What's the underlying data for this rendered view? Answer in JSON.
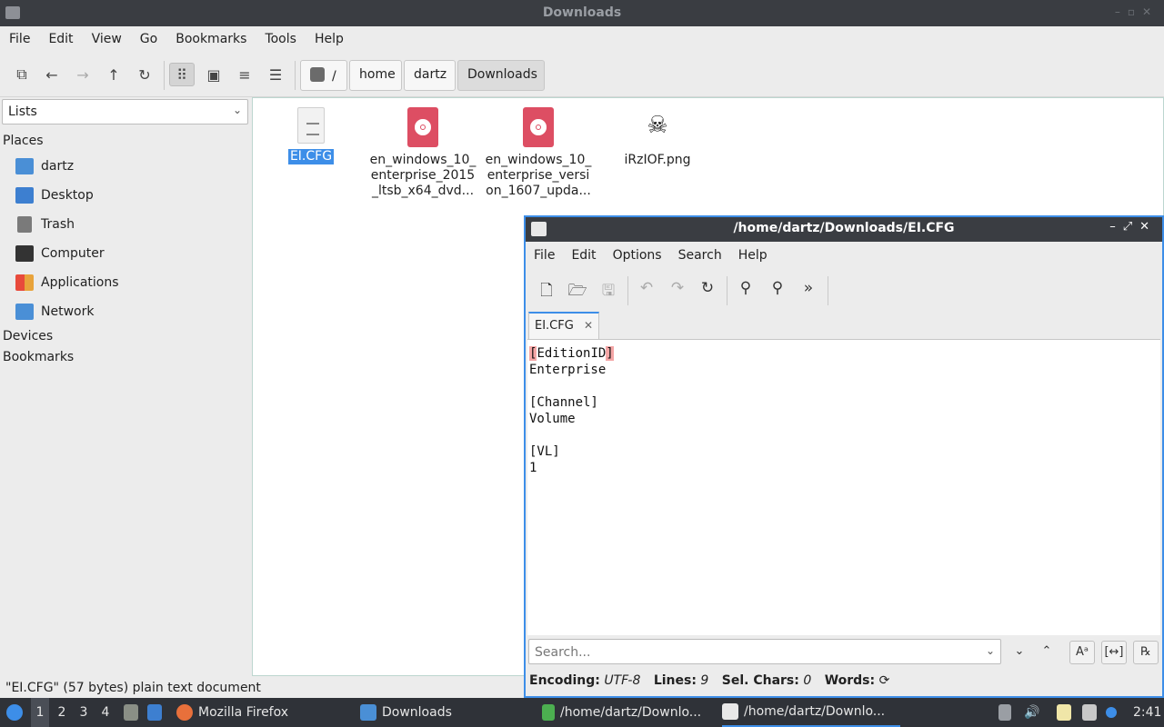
{
  "fm": {
    "title": "Downloads",
    "menu": [
      "File",
      "Edit",
      "View",
      "Go",
      "Bookmarks",
      "Tools",
      "Help"
    ],
    "breadcrumbs": [
      "/",
      "home",
      "dartz",
      "Downloads"
    ],
    "sidebar": {
      "mode": "Lists",
      "places_header": "Places",
      "places": [
        {
          "label": "dartz",
          "icon": "home-folder-icon",
          "color": "#4a8fd6"
        },
        {
          "label": "Desktop",
          "icon": "desktop-icon",
          "color": "#3d7fd0"
        },
        {
          "label": "Trash",
          "icon": "trash-icon",
          "color": "#7a7a7a"
        },
        {
          "label": "Computer",
          "icon": "computer-icon",
          "color": "#333333"
        },
        {
          "label": "Applications",
          "icon": "applications-icon",
          "color": "#e8a33b"
        },
        {
          "label": "Network",
          "icon": "network-icon",
          "color": "#4a8fd6"
        }
      ],
      "devices_header": "Devices",
      "bookmarks_header": "Bookmarks"
    },
    "files": [
      {
        "name": "EI.CFG",
        "type": "text",
        "selected": true
      },
      {
        "name": "en_windows_10_enterprise_2015_ltsb_x64_dvd...",
        "type": "iso",
        "selected": false
      },
      {
        "name": "en_windows_10_enterprise_version_1607_upda...",
        "type": "iso",
        "selected": false
      },
      {
        "name": "iRzIOF.png",
        "type": "image",
        "selected": false
      }
    ],
    "status": "\"EI.CFG\" (57 bytes) plain text document"
  },
  "editor": {
    "title": "/home/dartz/Downloads/EI.CFG",
    "menu": [
      "File",
      "Edit",
      "Options",
      "Search",
      "Help"
    ],
    "tab": "EI.CFG",
    "content_lines": [
      "[EditionID]",
      "Enterprise",
      "",
      "[Channel]",
      "Volume",
      "",
      "[VL]",
      "1"
    ],
    "search_placeholder": "Search...",
    "status": {
      "encoding_label": "Encoding:",
      "encoding": "UTF-8",
      "lines_label": "Lines:",
      "lines": "9",
      "selchars_label": "Sel. Chars:",
      "selchars": "0",
      "words_label": "Words:"
    }
  },
  "taskbar": {
    "workspaces": [
      "1",
      "2",
      "3",
      "4"
    ],
    "tasks": [
      "Mozilla Firefox",
      "Downloads",
      "/home/dartz/Downlo...",
      "/home/dartz/Downlo..."
    ],
    "clock": "2:41"
  },
  "colors": {
    "accent": "#3d8ee8",
    "iso": "#dd4e63",
    "highlight": "#f4a6a6"
  }
}
